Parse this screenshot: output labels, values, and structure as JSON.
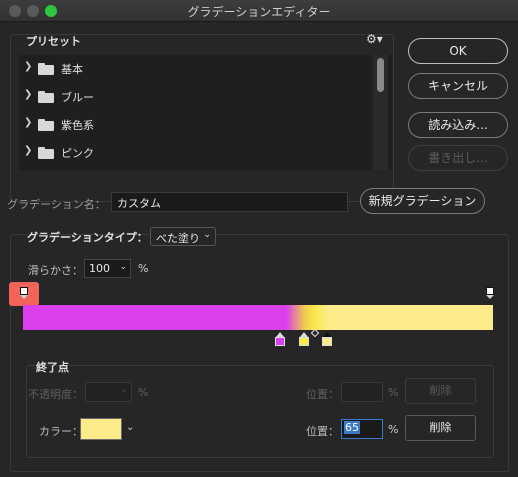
{
  "window": {
    "title": "グラデーションエディター"
  },
  "presets": {
    "label": "プリセット",
    "items": [
      {
        "label": "基本"
      },
      {
        "label": "ブルー"
      },
      {
        "label": "紫色系"
      },
      {
        "label": "ピンク"
      }
    ]
  },
  "buttons": {
    "ok": "OK",
    "cancel": "キャンセル",
    "load": "読み込み...",
    "export": "書き出し...",
    "new_gradient": "新規グラデーション"
  },
  "name": {
    "label": "グラデーション名：",
    "value": "カスタム"
  },
  "gradient": {
    "type_label": "グラデーションタイプ：",
    "type_value": "べた塗り",
    "smoothness_label": "滑らかさ：",
    "smoothness_value": "100",
    "smoothness_unit": "%",
    "colors": {
      "start": "#d93fea",
      "mid": "#fbe94a",
      "end": "#fdeb8a"
    },
    "color_stops": [
      {
        "color": "#d93fea",
        "location": 0.55
      },
      {
        "color": "#fbe94a",
        "location": 0.6
      },
      {
        "color": "#fdeb8a",
        "location": 0.65,
        "selected": true
      }
    ],
    "opacity_stops": [
      {
        "location": 0
      },
      {
        "location": 100
      }
    ]
  },
  "stops": {
    "label": "終了点",
    "opacity_label": "不透明度：",
    "opacity_unit": "%",
    "location_label": "位置：",
    "location_unit": "%",
    "delete_label": "削除",
    "color_label": "カラー：",
    "color_value": "#fdeb8a",
    "location_value": "65"
  }
}
